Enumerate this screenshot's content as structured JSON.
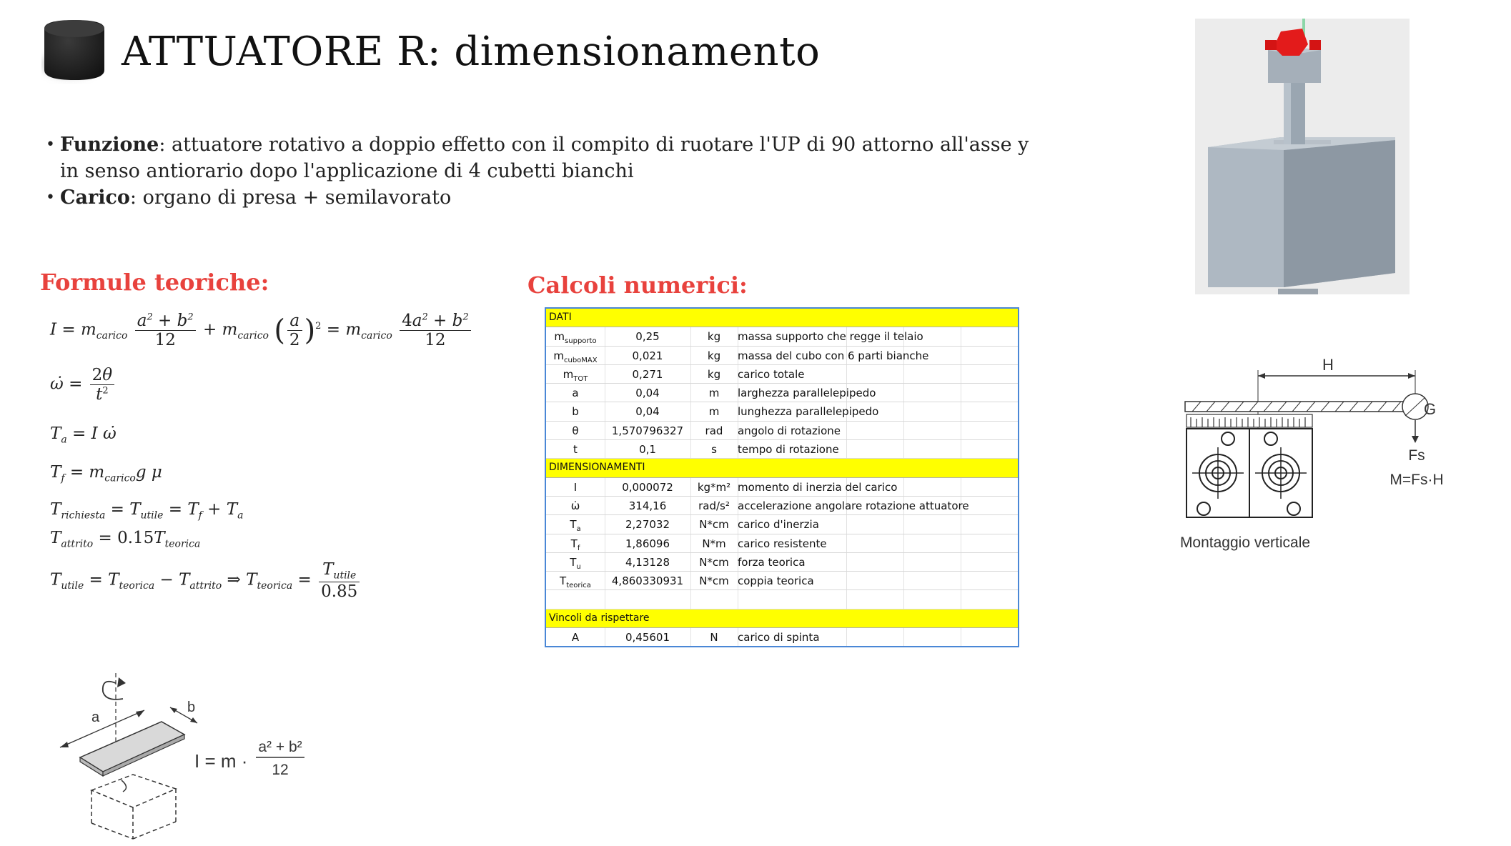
{
  "title": "ATTUATORE R: dimensionamento",
  "bullets": [
    {
      "label": "Funzione",
      "text": ": attuatore rotativo a doppio effetto con il compito di ruotare l'UP di 90 attorno all'asse y in senso antiorario dopo l'applicazione di 4 cubetti bianchi"
    },
    {
      "label": "Carico",
      "text": ": organo di presa + semilavorato"
    }
  ],
  "sections": {
    "formule": "Formule teoriche:",
    "calcoli": "Calcoli numerici:"
  },
  "table": {
    "dati_header": "DATI",
    "dati": [
      {
        "sym": "m",
        "sub": "supporto",
        "val": "0,25",
        "unit": "kg",
        "desc": "massa supporto che regge il telaio"
      },
      {
        "sym": "m",
        "sub": "cuboMAX",
        "val": "0,021",
        "unit": "kg",
        "desc": "massa del cubo con 6 parti bianche"
      },
      {
        "sym": "m",
        "sub": "TOT",
        "val": "0,271",
        "unit": "kg",
        "desc": "carico totale"
      },
      {
        "sym": "a",
        "sub": "",
        "val": "0,04",
        "unit": "m",
        "desc": "larghezza parallelepipedo"
      },
      {
        "sym": "b",
        "sub": "",
        "val": "0,04",
        "unit": "m",
        "desc": "lunghezza parallelepipedo"
      },
      {
        "sym": "θ",
        "sub": "",
        "val": "1,570796327",
        "unit": "rad",
        "desc": "angolo di rotazione"
      },
      {
        "sym": "t",
        "sub": "",
        "val": "0,1",
        "unit": "s",
        "desc": "tempo di rotazione"
      }
    ],
    "dim_header": "DIMENSIONAMENTI",
    "dim": [
      {
        "sym": "I",
        "sub": "",
        "val": "0,000072",
        "unit": "kg*m²",
        "desc": "momento di inerzia del carico"
      },
      {
        "sym": "ω̇",
        "sub": "",
        "val": "314,16",
        "unit": "rad/s²",
        "desc": "accelerazione angolare rotazione attuatore"
      },
      {
        "sym": "T",
        "sub": "a",
        "val": "2,27032",
        "unit": "N*cm",
        "desc": "carico d'inerzia"
      },
      {
        "sym": "T",
        "sub": "f",
        "val": "1,86096",
        "unit": "N*m",
        "desc": "carico resistente"
      },
      {
        "sym": "T",
        "sub": "u",
        "val": "4,13128",
        "unit": "N*cm",
        "desc": "forza teorica"
      },
      {
        "sym": "T",
        "sub": "teorica",
        "val": "4,860330931",
        "unit": "N*cm",
        "desc": "coppia teorica"
      }
    ],
    "vincoli_header": "Vincoli da rispettare",
    "vincoli": [
      {
        "sym": "A",
        "sub": "",
        "val": "0,45601",
        "unit": "N",
        "desc": "carico di spinta"
      }
    ]
  },
  "mount": {
    "h_label": "H",
    "fs_label": "Fs",
    "moment_label": "M=Fs·H",
    "g_label": "G",
    "caption": "Montaggio verticale"
  },
  "inertia": {
    "a_label": "a",
    "b_label": "b",
    "formula_lhs": "I = m ·",
    "formula_num": "a² + b²",
    "formula_den": "12"
  }
}
